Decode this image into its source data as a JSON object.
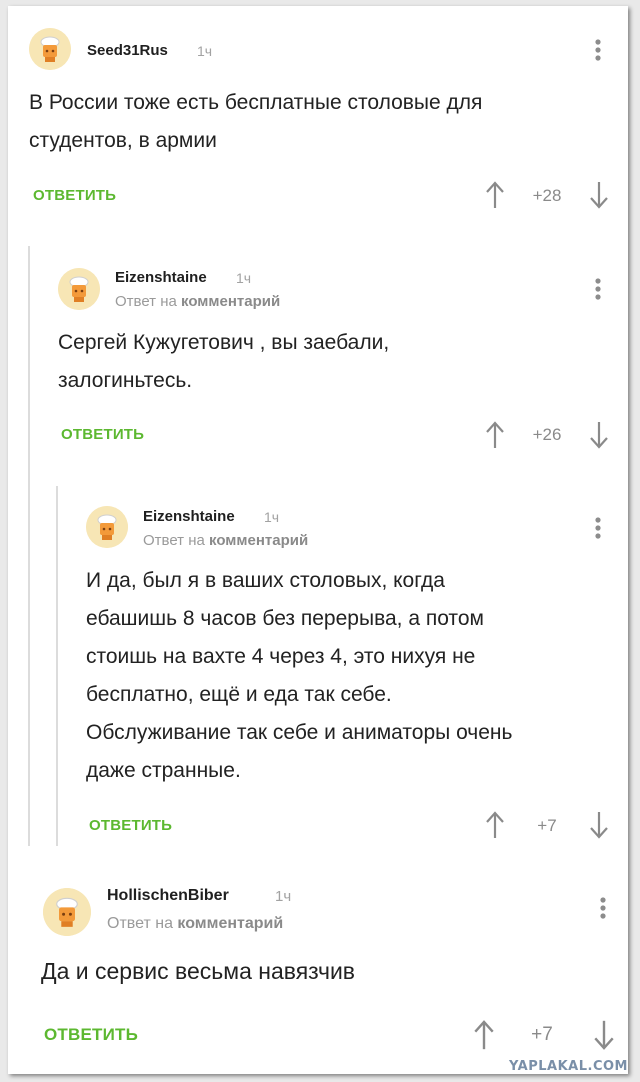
{
  "comments": [
    {
      "username": "Seed31Rus",
      "time": "1ч",
      "text_lines": [
        "В России тоже есть бесплатные столовые для",
        "студентов, в армии"
      ],
      "reply_label": "ОТВЕТИТЬ",
      "score": "+28"
    },
    {
      "username": "Eizenshtaine",
      "time": "1ч",
      "reply_prefix": "Ответ на",
      "reply_target": "комментарий",
      "text_lines": [
        "Сергей Кужугетович , вы заебали,",
        "залогиньтесь."
      ],
      "reply_label": "ОТВЕТИТЬ",
      "score": "+26"
    },
    {
      "username": "Eizenshtaine",
      "time": "1ч",
      "reply_prefix": "Ответ на",
      "reply_target": "комментарий",
      "text_lines": [
        "И да, был я в ваших столовых, когда",
        "ебашишь 8 часов без перерыва, а потом",
        "стоишь на вахте 4 через 4, это нихуя не",
        "бесплатно, ещё и еда так себе.",
        "Обслуживание так себе и аниматоры очень",
        "даже странные."
      ],
      "reply_label": "ОТВЕТИТЬ",
      "score": "+7"
    },
    {
      "username": "HollischenBiber",
      "time": "1ч",
      "reply_prefix": "Ответ на",
      "reply_target": "комментарий",
      "text_lines": [
        "Да и сервис весьма навязчив"
      ],
      "reply_label": "ОТВЕТИТЬ",
      "score": "+7"
    }
  ],
  "watermark": "YAPLAKAL.COM",
  "colors": {
    "reply_green": "#5cb830",
    "muted": "#9a9a9a",
    "text": "#222222",
    "avatar_bg": "#f7e6b5"
  },
  "icons": [
    "avatar-chef",
    "arrow-up-icon",
    "arrow-down-icon",
    "more-vertical-icon"
  ]
}
